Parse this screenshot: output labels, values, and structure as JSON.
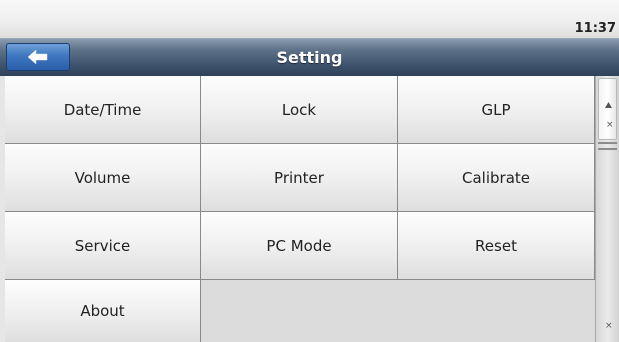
{
  "status_bar": {
    "time": "11:37"
  },
  "header": {
    "title": "Setting",
    "back_icon": "back-arrow-icon"
  },
  "menu": {
    "items": [
      {
        "label": "Date/Time"
      },
      {
        "label": "Lock"
      },
      {
        "label": "GLP"
      },
      {
        "label": "Volume"
      },
      {
        "label": "Printer"
      },
      {
        "label": "Calibrate"
      },
      {
        "label": "Service"
      },
      {
        "label": "PC Mode"
      },
      {
        "label": "Reset"
      },
      {
        "label": "About"
      }
    ]
  },
  "colors": {
    "header_bar": "#3c506a",
    "back_button": "#3f77c0",
    "grid_background": "#dcdcdc"
  }
}
